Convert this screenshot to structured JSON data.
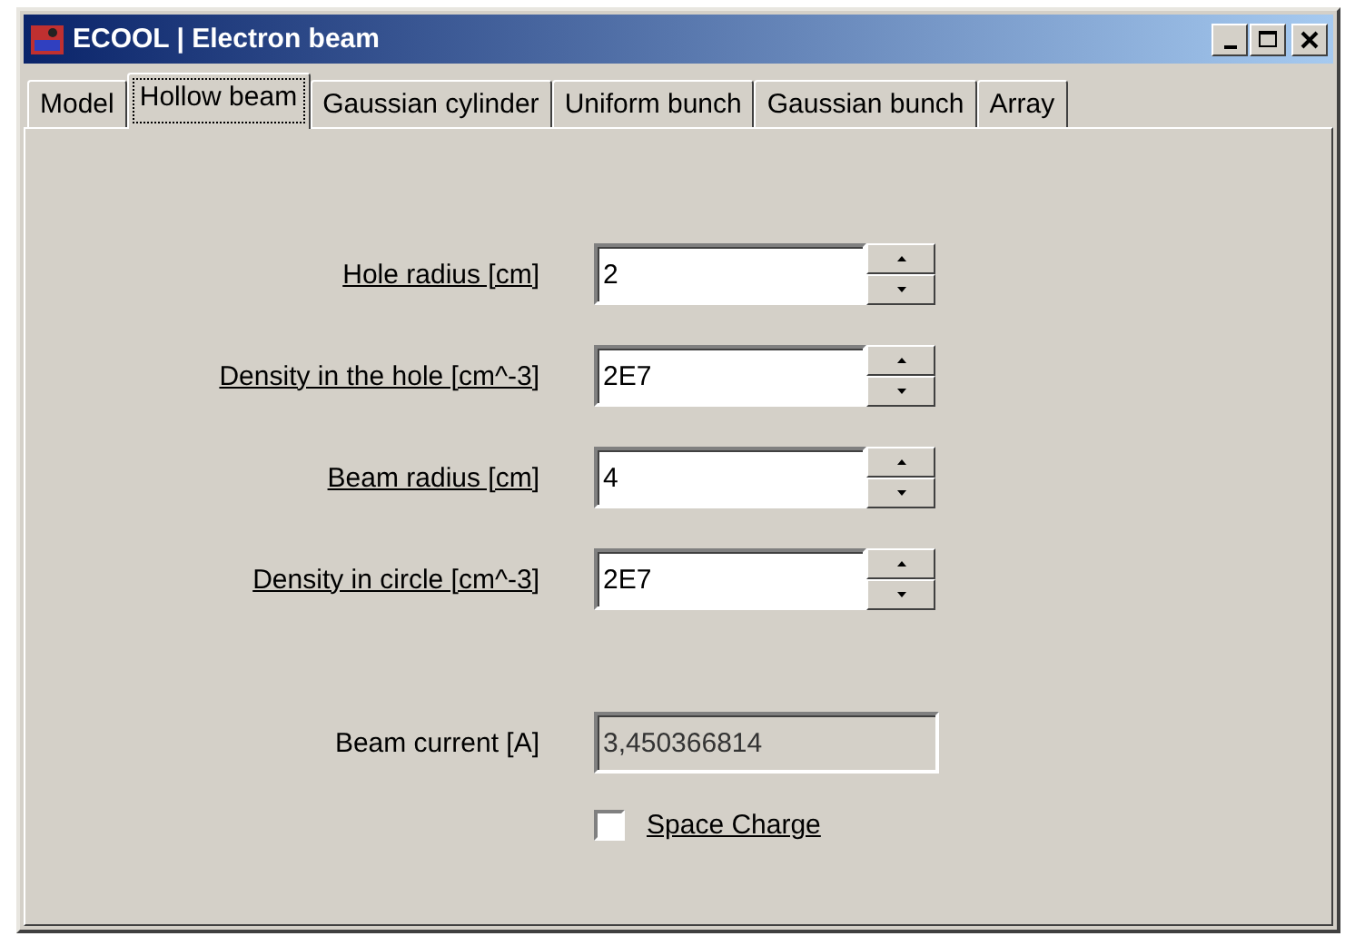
{
  "window": {
    "title": "ECOOL | Electron beam"
  },
  "tabs": [
    {
      "label": "Model",
      "selected": false
    },
    {
      "label": "Hollow beam",
      "selected": true
    },
    {
      "label": "Gaussian cylinder",
      "selected": false
    },
    {
      "label": "Uniform bunch",
      "selected": false
    },
    {
      "label": "Gaussian bunch",
      "selected": false
    },
    {
      "label": "Array",
      "selected": false
    }
  ],
  "fields": [
    {
      "kind": "spin",
      "label": "Hole radius [cm]",
      "value": "2"
    },
    {
      "kind": "spin",
      "label": "Density in the hole [cm^-3]",
      "value": "2E7"
    },
    {
      "kind": "spin",
      "label": "Beam radius [cm]",
      "value": "4"
    },
    {
      "kind": "spin",
      "label": "Density in circle [cm^-3]",
      "value": "2E7"
    },
    {
      "kind": "readonly",
      "label": "Beam current [A]",
      "value": "3,450366814"
    }
  ],
  "space_charge": {
    "label": "Space Charge",
    "checked": false
  }
}
